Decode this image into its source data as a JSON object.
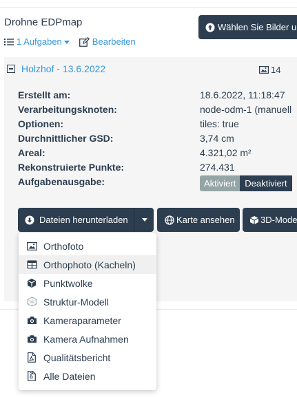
{
  "project": {
    "title": "Drohne EDPmap",
    "select_images_label": "Wählen Sie Bilder un",
    "tasks_label": "1 Aufgaben",
    "edit_label": "Bearbeiten"
  },
  "task": {
    "name": "Holzhof - 13.6.2022",
    "image_count": "14",
    "properties": [
      {
        "label": "Erstellt am:",
        "value": "18.6.2022, 11:18:47"
      },
      {
        "label": "Verarbeitungsknoten:",
        "value": "node-odm-1 (manuell"
      },
      {
        "label": "Optionen:",
        "value": "tiles: true"
      },
      {
        "label": "Durchnittlicher GSD:",
        "value": "3,74 cm"
      },
      {
        "label": "Areal:",
        "value": "4.321,02 m²"
      },
      {
        "label": "Rekonstruierte Punkte:",
        "value": "274.431"
      },
      {
        "label": "Aufgabenausgabe:",
        "value": ""
      }
    ],
    "output_toggle": {
      "active_label": "Aktiviert",
      "inactive_label": "Deaktiviert"
    }
  },
  "actions": {
    "download_label": "Dateien herunterladen",
    "map_label": "Karte ansehen",
    "model_label": "3D-Mode"
  },
  "download_menu": {
    "items": [
      {
        "label": "Orthofoto",
        "icon": "image-icon"
      },
      {
        "label": "Orthophoto (Kacheln)",
        "icon": "table-icon"
      },
      {
        "label": "Punktwolke",
        "icon": "cube-icon"
      },
      {
        "label": "Struktur-Modell",
        "icon": "cube-wireframe-icon"
      },
      {
        "label": "Kameraparameter",
        "icon": "camera-icon"
      },
      {
        "label": "Kamera Aufnahmen",
        "icon": "camera-icon"
      },
      {
        "label": "Qualitätsbericht",
        "icon": "pdf-file-icon"
      },
      {
        "label": "Alle Dateien",
        "icon": "zip-file-icon"
      }
    ],
    "hovered_index": 1
  },
  "colors": {
    "dark": "#2c3e50",
    "link": "#3498db",
    "toggle_active": "#95a5a6",
    "panel_bg": "#f5f5f5"
  }
}
